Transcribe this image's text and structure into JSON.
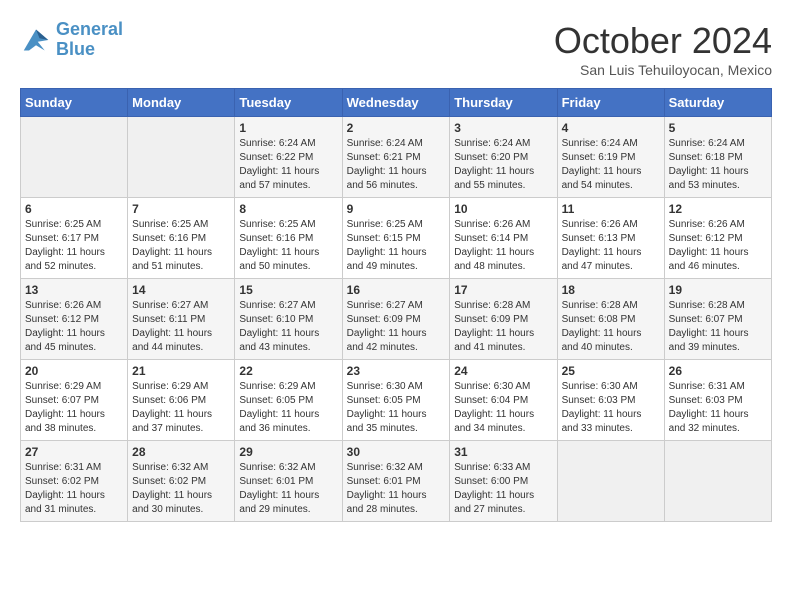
{
  "header": {
    "logo": {
      "line1": "General",
      "line2": "Blue"
    },
    "title": "October 2024",
    "location": "San Luis Tehuiloyocan, Mexico"
  },
  "days_of_week": [
    "Sunday",
    "Monday",
    "Tuesday",
    "Wednesday",
    "Thursday",
    "Friday",
    "Saturday"
  ],
  "weeks": [
    [
      {
        "num": "",
        "info": ""
      },
      {
        "num": "",
        "info": ""
      },
      {
        "num": "1",
        "info": "Sunrise: 6:24 AM\nSunset: 6:22 PM\nDaylight: 11 hours and 57 minutes."
      },
      {
        "num": "2",
        "info": "Sunrise: 6:24 AM\nSunset: 6:21 PM\nDaylight: 11 hours and 56 minutes."
      },
      {
        "num": "3",
        "info": "Sunrise: 6:24 AM\nSunset: 6:20 PM\nDaylight: 11 hours and 55 minutes."
      },
      {
        "num": "4",
        "info": "Sunrise: 6:24 AM\nSunset: 6:19 PM\nDaylight: 11 hours and 54 minutes."
      },
      {
        "num": "5",
        "info": "Sunrise: 6:24 AM\nSunset: 6:18 PM\nDaylight: 11 hours and 53 minutes."
      }
    ],
    [
      {
        "num": "6",
        "info": "Sunrise: 6:25 AM\nSunset: 6:17 PM\nDaylight: 11 hours and 52 minutes."
      },
      {
        "num": "7",
        "info": "Sunrise: 6:25 AM\nSunset: 6:16 PM\nDaylight: 11 hours and 51 minutes."
      },
      {
        "num": "8",
        "info": "Sunrise: 6:25 AM\nSunset: 6:16 PM\nDaylight: 11 hours and 50 minutes."
      },
      {
        "num": "9",
        "info": "Sunrise: 6:25 AM\nSunset: 6:15 PM\nDaylight: 11 hours and 49 minutes."
      },
      {
        "num": "10",
        "info": "Sunrise: 6:26 AM\nSunset: 6:14 PM\nDaylight: 11 hours and 48 minutes."
      },
      {
        "num": "11",
        "info": "Sunrise: 6:26 AM\nSunset: 6:13 PM\nDaylight: 11 hours and 47 minutes."
      },
      {
        "num": "12",
        "info": "Sunrise: 6:26 AM\nSunset: 6:12 PM\nDaylight: 11 hours and 46 minutes."
      }
    ],
    [
      {
        "num": "13",
        "info": "Sunrise: 6:26 AM\nSunset: 6:12 PM\nDaylight: 11 hours and 45 minutes."
      },
      {
        "num": "14",
        "info": "Sunrise: 6:27 AM\nSunset: 6:11 PM\nDaylight: 11 hours and 44 minutes."
      },
      {
        "num": "15",
        "info": "Sunrise: 6:27 AM\nSunset: 6:10 PM\nDaylight: 11 hours and 43 minutes."
      },
      {
        "num": "16",
        "info": "Sunrise: 6:27 AM\nSunset: 6:09 PM\nDaylight: 11 hours and 42 minutes."
      },
      {
        "num": "17",
        "info": "Sunrise: 6:28 AM\nSunset: 6:09 PM\nDaylight: 11 hours and 41 minutes."
      },
      {
        "num": "18",
        "info": "Sunrise: 6:28 AM\nSunset: 6:08 PM\nDaylight: 11 hours and 40 minutes."
      },
      {
        "num": "19",
        "info": "Sunrise: 6:28 AM\nSunset: 6:07 PM\nDaylight: 11 hours and 39 minutes."
      }
    ],
    [
      {
        "num": "20",
        "info": "Sunrise: 6:29 AM\nSunset: 6:07 PM\nDaylight: 11 hours and 38 minutes."
      },
      {
        "num": "21",
        "info": "Sunrise: 6:29 AM\nSunset: 6:06 PM\nDaylight: 11 hours and 37 minutes."
      },
      {
        "num": "22",
        "info": "Sunrise: 6:29 AM\nSunset: 6:05 PM\nDaylight: 11 hours and 36 minutes."
      },
      {
        "num": "23",
        "info": "Sunrise: 6:30 AM\nSunset: 6:05 PM\nDaylight: 11 hours and 35 minutes."
      },
      {
        "num": "24",
        "info": "Sunrise: 6:30 AM\nSunset: 6:04 PM\nDaylight: 11 hours and 34 minutes."
      },
      {
        "num": "25",
        "info": "Sunrise: 6:30 AM\nSunset: 6:03 PM\nDaylight: 11 hours and 33 minutes."
      },
      {
        "num": "26",
        "info": "Sunrise: 6:31 AM\nSunset: 6:03 PM\nDaylight: 11 hours and 32 minutes."
      }
    ],
    [
      {
        "num": "27",
        "info": "Sunrise: 6:31 AM\nSunset: 6:02 PM\nDaylight: 11 hours and 31 minutes."
      },
      {
        "num": "28",
        "info": "Sunrise: 6:32 AM\nSunset: 6:02 PM\nDaylight: 11 hours and 30 minutes."
      },
      {
        "num": "29",
        "info": "Sunrise: 6:32 AM\nSunset: 6:01 PM\nDaylight: 11 hours and 29 minutes."
      },
      {
        "num": "30",
        "info": "Sunrise: 6:32 AM\nSunset: 6:01 PM\nDaylight: 11 hours and 28 minutes."
      },
      {
        "num": "31",
        "info": "Sunrise: 6:33 AM\nSunset: 6:00 PM\nDaylight: 11 hours and 27 minutes."
      },
      {
        "num": "",
        "info": ""
      },
      {
        "num": "",
        "info": ""
      }
    ]
  ]
}
